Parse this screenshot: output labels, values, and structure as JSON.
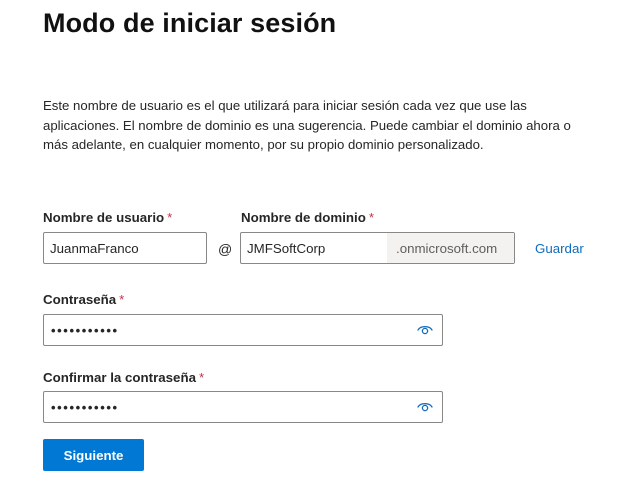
{
  "page": {
    "title": "Modo de iniciar sesión",
    "description": "Este nombre de usuario es el que utilizará para iniciar sesión cada vez que use las aplicaciones. El nombre de dominio es una sugerencia. Puede cambiar el dominio ahora o más adelante, en cualquier momento, por su propio dominio personalizado."
  },
  "form": {
    "required_marker": "*",
    "username": {
      "label": "Nombre de usuario",
      "value": "JuanmaFranco"
    },
    "at_symbol": "@",
    "domain": {
      "label": "Nombre de dominio",
      "value": "JMFSoftCorp",
      "suffix": ".onmicrosoft.com"
    },
    "save_link": "Guardar",
    "password": {
      "label": "Contraseña",
      "masked_value": "•••••••••••",
      "toggle_icon": "eye-icon"
    },
    "confirm_password": {
      "label": "Confirmar la contraseña",
      "masked_value": "•••••••••••",
      "toggle_icon": "eye-icon"
    },
    "next_button": "Siguiente"
  },
  "colors": {
    "accent": "#0078d4",
    "link": "#0f6cbd",
    "required": "#c4314b",
    "border": "#8a8886",
    "suffix_bg": "#f3f2f1"
  }
}
